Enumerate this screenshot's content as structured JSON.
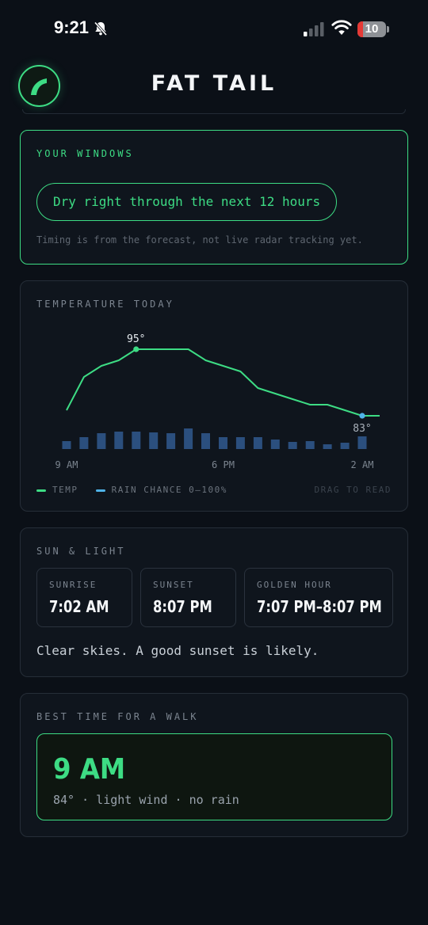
{
  "status_bar": {
    "time": "9:21",
    "battery": "10",
    "icons": [
      "bell-slash-icon",
      "cellular-signal-icon",
      "wifi-icon",
      "battery-icon"
    ]
  },
  "header": {
    "title": "FAT TAIL",
    "logo_icon": "fat-tail-logo-icon"
  },
  "windows": {
    "label": "YOUR WINDOWS",
    "pill": "Dry right through the next 12 hours",
    "note": "Timing is from the forecast, not live radar tracking yet."
  },
  "temperature": {
    "label": "TEMPERATURE TODAY",
    "high_label": "95°",
    "current_label": "83°",
    "legend_temp": "TEMP",
    "legend_rain": "RAIN CHANCE 0–100%",
    "drag_hint": "DRAG TO READ",
    "colors": {
      "temp": "#3ddc84",
      "rain": "#2b4f7e",
      "marker": "#4fb3e8"
    }
  },
  "chart_data": {
    "type": "line",
    "x": [
      "9 AM",
      "10 AM",
      "11 AM",
      "12 PM",
      "1 PM",
      "2 PM",
      "3 PM",
      "4 PM",
      "5 PM",
      "6 PM",
      "7 PM",
      "8 PM",
      "9 PM",
      "10 PM",
      "11 PM",
      "12 AM",
      "1 AM",
      "2 AM"
    ],
    "tick_labels": [
      "9 AM",
      "6 PM",
      "2 AM"
    ],
    "series": [
      {
        "name": "TEMP",
        "type": "line",
        "values": [
          84,
          90,
          92,
          93,
          95,
          95,
          95,
          95,
          93,
          92,
          91,
          88,
          87,
          86,
          85,
          85,
          84,
          83
        ]
      },
      {
        "name": "RAIN CHANCE 0–100%",
        "type": "bar",
        "values": [
          10,
          15,
          20,
          22,
          22,
          21,
          20,
          26,
          20,
          15,
          15,
          15,
          12,
          9,
          10,
          6,
          8,
          16
        ]
      }
    ],
    "annotations": [
      {
        "x": "1 PM",
        "text": "95°"
      },
      {
        "x": "2 AM",
        "text": "83°"
      }
    ]
  },
  "sun": {
    "label": "SUN & LIGHT",
    "sunrise_label": "SUNRISE",
    "sunrise": "7:02 AM",
    "sunset_label": "SUNSET",
    "sunset": "8:07 PM",
    "golden_label": "GOLDEN HOUR",
    "golden": "7:07 PM–8:07 PM",
    "summary": "Clear skies. A good sunset is likely."
  },
  "walk": {
    "label": "BEST TIME FOR A WALK",
    "time": "9 AM",
    "detail": "84° · light wind · no rain"
  }
}
